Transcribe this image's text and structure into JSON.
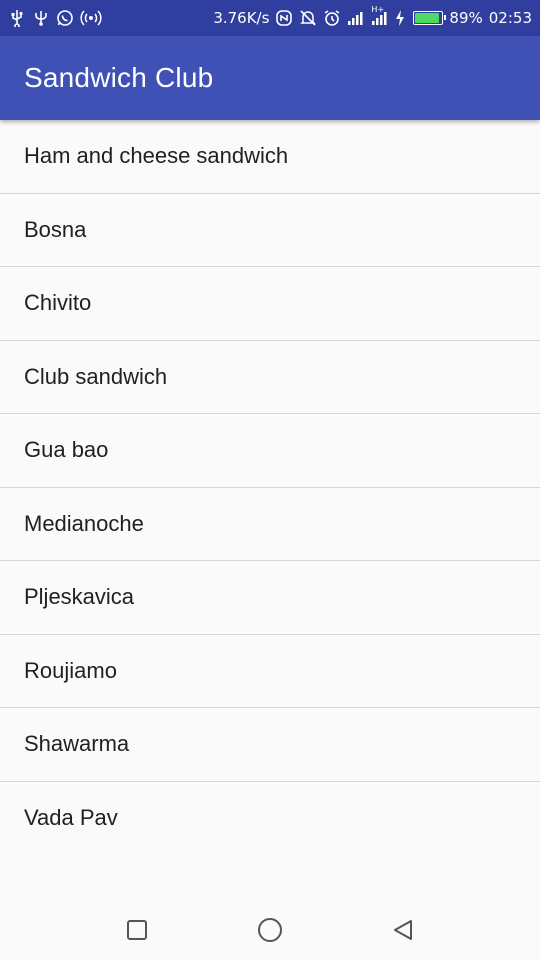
{
  "status_bar": {
    "net_speed": "3.76K/s",
    "battery_percent": "89%",
    "battery_level": 0.89,
    "time": "02:53",
    "signal_label": "H+",
    "left_icons": [
      "usb-icon",
      "usb-debug-icon",
      "whatsapp-icon",
      "hotspot-icon"
    ],
    "right_icons": [
      "nfc-icon",
      "mute-icon",
      "alarm-icon",
      "signal-icon",
      "signal-hplus-icon",
      "charging-icon"
    ]
  },
  "app_bar": {
    "title": "Sandwich Club"
  },
  "sandwiches": [
    "Ham and cheese sandwich",
    "Bosna",
    "Chivito",
    "Club sandwich",
    "Gua bao",
    "Medianoche",
    "Pljeskavica",
    "Roujiamo",
    "Shawarma",
    "Vada Pav"
  ],
  "colors": {
    "status_bar": "#303f9f",
    "primary": "#3f51b5",
    "battery": "#4cd964"
  },
  "nav_bar": {
    "buttons": [
      "recents-button",
      "home-button",
      "back-button"
    ]
  }
}
